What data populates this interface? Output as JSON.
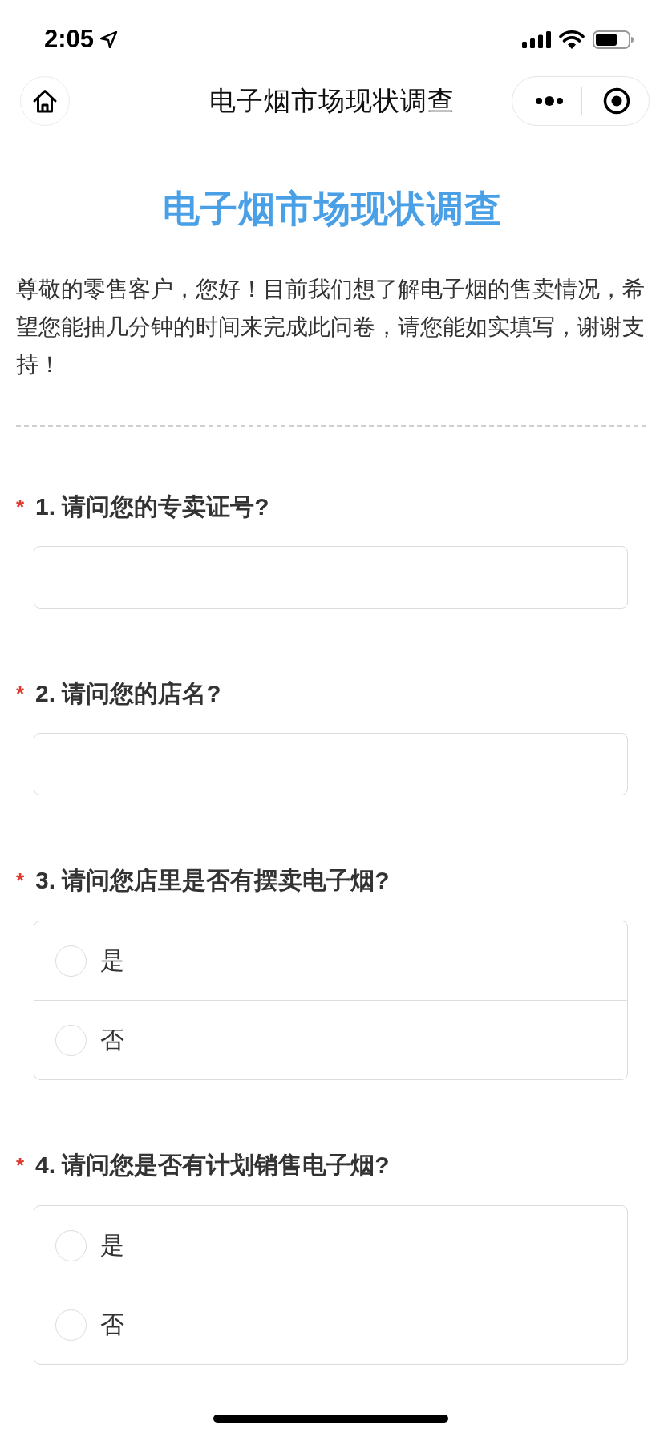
{
  "status_bar": {
    "time": "2:05"
  },
  "nav_bar": {
    "title": "电子烟市场现状调查"
  },
  "survey": {
    "title": "电子烟市场现状调查",
    "intro": "尊敬的零售客户，您好！目前我们想了解电子烟的售卖情况，希望您能抽几分钟的时间来完成此问卷，请您能如实填写，谢谢支持！",
    "questions": [
      {
        "kind": "text",
        "required_mark": "*",
        "label": "1. 请问您的专卖证号?"
      },
      {
        "kind": "text",
        "required_mark": "*",
        "label": "2. 请问您的店名?"
      },
      {
        "kind": "radio",
        "required_mark": "*",
        "label": "3. 请问您店里是否有摆卖电子烟?",
        "options": [
          {
            "label": "是",
            "selected": false
          },
          {
            "label": "否",
            "selected": false
          }
        ]
      },
      {
        "kind": "radio",
        "required_mark": "*",
        "label": "4. 请问您是否有计划销售电子烟?",
        "options": [
          {
            "label": "是",
            "selected": false
          },
          {
            "label": "否",
            "selected": false
          }
        ]
      }
    ]
  }
}
